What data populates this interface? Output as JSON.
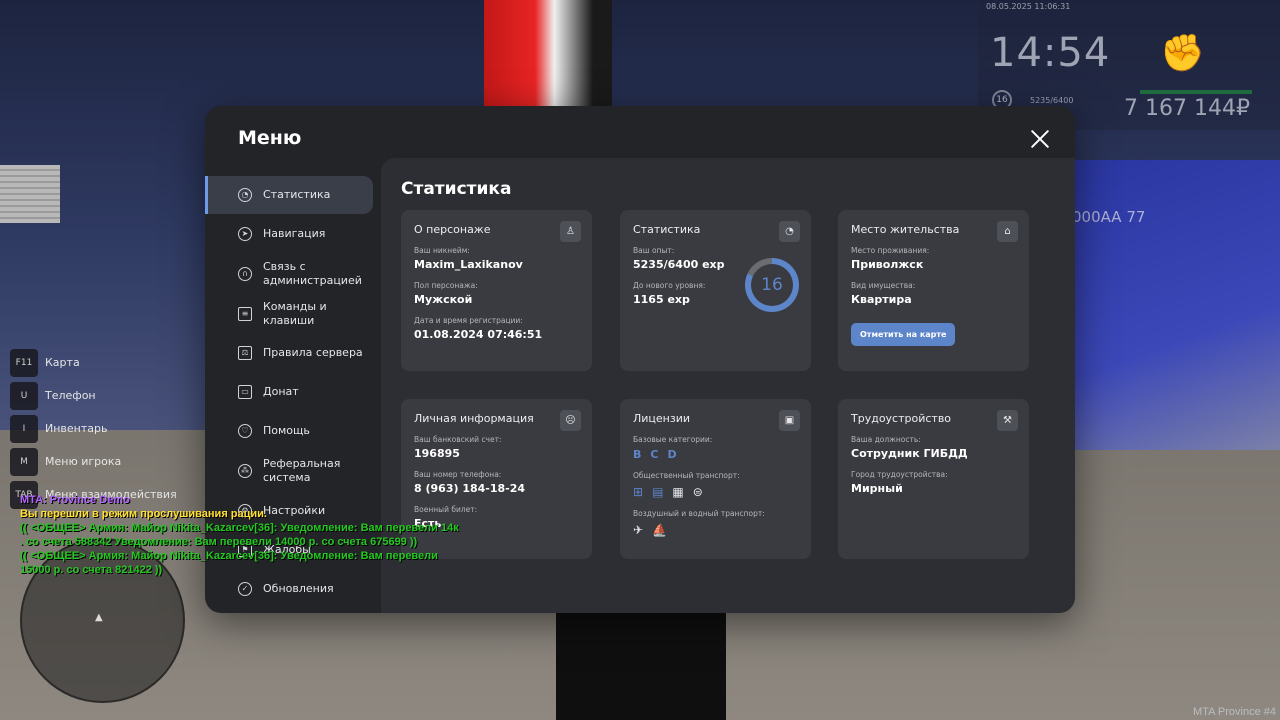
{
  "hud": {
    "datetime": "08.05.2025 11:06:31",
    "time": "14:54",
    "level": "16",
    "exp": "5235/6400",
    "money": "7 167 144₽"
  },
  "scene": {
    "plate": "000AA 77"
  },
  "keybinds": [
    {
      "key": "F11",
      "label": "Карта"
    },
    {
      "key": "U",
      "label": "Телефон"
    },
    {
      "key": "I",
      "label": "Инвентарь"
    },
    {
      "key": "M",
      "label": "Меню игрока"
    },
    {
      "key": "TAB",
      "label": "Меню взаимодействия"
    }
  ],
  "chat": [
    {
      "text": "MTA: Province Demo",
      "color": "purple"
    },
    {
      "text": "Вы перешли в режим прослушивания рации.",
      "color": "yellow"
    },
    {
      "text": "(( <ОБЩЕЕ> Армия: Майор Nikita_Kazarcev[36]: Уведомление: Вам перевели 14к",
      "color": "green"
    },
    {
      "text": ". со счета 588342 Уведомление: Вам перевели 14000 р. со счета 675699 ))",
      "color": "green"
    },
    {
      "text": "(( <ОБЩЕЕ> Армия: Майор Nikita_Kazarcev[36]: Уведомление: Вам перевели",
      "color": "green"
    },
    {
      "text": " 15000 р. со счета 821422 ))",
      "color": "green"
    }
  ],
  "watermark": "MTA Province #4",
  "menu": {
    "title": "Меню",
    "sidebar": [
      {
        "label": "Статистика",
        "icon": "pie-chart-icon",
        "active": true
      },
      {
        "label": "Навигация",
        "icon": "compass-icon"
      },
      {
        "label": "Связь с администрацией",
        "icon": "headset-icon"
      },
      {
        "label": "Команды и клавиши",
        "icon": "document-icon"
      },
      {
        "label": "Правила сервера",
        "icon": "scales-icon"
      },
      {
        "label": "Донат",
        "icon": "wallet-icon"
      },
      {
        "label": "Помощь",
        "icon": "heart-hand-icon"
      },
      {
        "label": "Реферальная система",
        "icon": "network-icon"
      },
      {
        "label": "Настройки",
        "icon": "gear-icon"
      },
      {
        "label": "Жалобы",
        "icon": "flag-icon"
      },
      {
        "label": "Обновления",
        "icon": "check-circle-icon"
      }
    ],
    "content_title": "Статистика",
    "cards": {
      "character": {
        "title": "О персонаже",
        "nickname_label": "Ваш никнейм:",
        "nickname": "Maxim_Laxikanov",
        "gender_label": "Пол персонажа:",
        "gender": "Мужской",
        "reg_label": "Дата и время регистрации:",
        "reg": "01.08.2024 07:46:51"
      },
      "stats": {
        "title": "Статистика",
        "exp_label": "Ваш опыт:",
        "exp": "5235/6400 exp",
        "next_label": "До нового уровня:",
        "next": "1165 exp",
        "level": "16",
        "level_progress": 0.818
      },
      "residence": {
        "title": "Место жительства",
        "place_label": "Место проживания:",
        "place": "Приволжск",
        "property_label": "Вид имущества:",
        "property": "Квартира",
        "map_button": "Отметить на карте"
      },
      "personal": {
        "title": "Личная информация",
        "bank_label": "Ваш банковский счет:",
        "bank": "196895",
        "phone_label": "Ваш номер телефона:",
        "phone": "8 (963) 184-18-24",
        "military_label": "Военный билет:",
        "military": "Есть"
      },
      "licenses": {
        "title": "Лицензии",
        "base_label": "Базовые категории:",
        "base": [
          "B",
          "C",
          "D"
        ],
        "public_label": "Общественный транспорт:",
        "air_water_label": "Воздушный и водный транспорт:"
      },
      "employment": {
        "title": "Трудоустройство",
        "position_label": "Ваша должность:",
        "position": "Сотрудник ГИБДД",
        "city_label": "Город трудоустройства:",
        "city": "Мирный"
      }
    }
  }
}
